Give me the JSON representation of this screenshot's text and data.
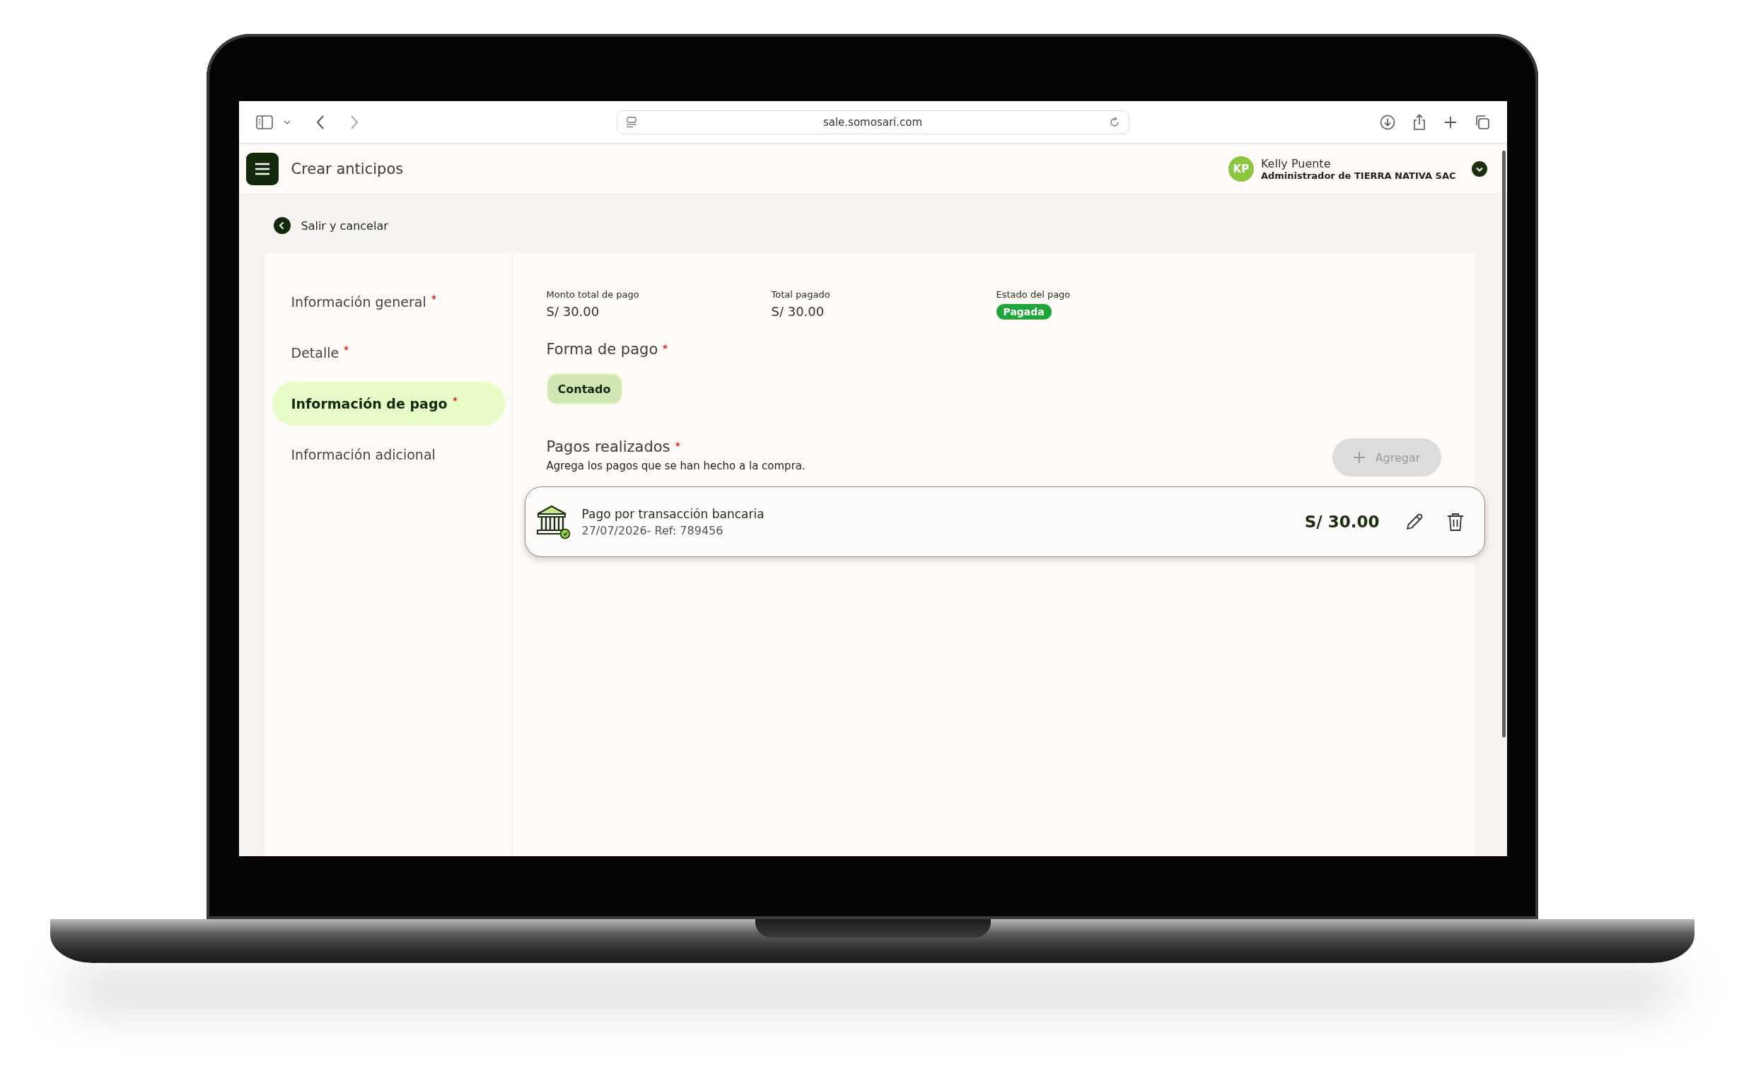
{
  "browser": {
    "url": "sale.somosari.com"
  },
  "header": {
    "title": "Crear anticipos",
    "user": {
      "initials": "KP",
      "name": "Kelly Puente",
      "role": "Administrador de TIERRA NATIVA SAC"
    }
  },
  "back_link": "Salir y cancelar",
  "sidebar": {
    "items": [
      {
        "label": "Información general",
        "required": true,
        "selected": false
      },
      {
        "label": "Detalle",
        "required": true,
        "selected": false
      },
      {
        "label": "Información de pago",
        "required": true,
        "selected": true
      },
      {
        "label": "Información adicional",
        "required": false,
        "selected": false
      }
    ]
  },
  "summary": [
    {
      "kind": "text",
      "label": "Monto total de pago",
      "value": "S/ 30.00"
    },
    {
      "kind": "text",
      "label": "Total pagado",
      "value": "S/ 30.00"
    },
    {
      "kind": "badge",
      "label": "Estado del pago",
      "value": "Pagada",
      "color": "#1fa53a"
    }
  ],
  "payment_method": {
    "title": "Forma de pago",
    "required": true,
    "options": [
      {
        "label": "Contado",
        "selected": true
      }
    ]
  },
  "payments": {
    "title": "Pagos realizados",
    "required": true,
    "subtitle": "Agrega los pagos que se han hecho a la compra.",
    "add_button": {
      "label": "Agregar",
      "disabled": true
    },
    "items": [
      {
        "title": "Pago por transacción bancaria",
        "subtitle": "27/07/2026- Ref: 789456",
        "amount": "S/ 30.00"
      }
    ]
  }
}
